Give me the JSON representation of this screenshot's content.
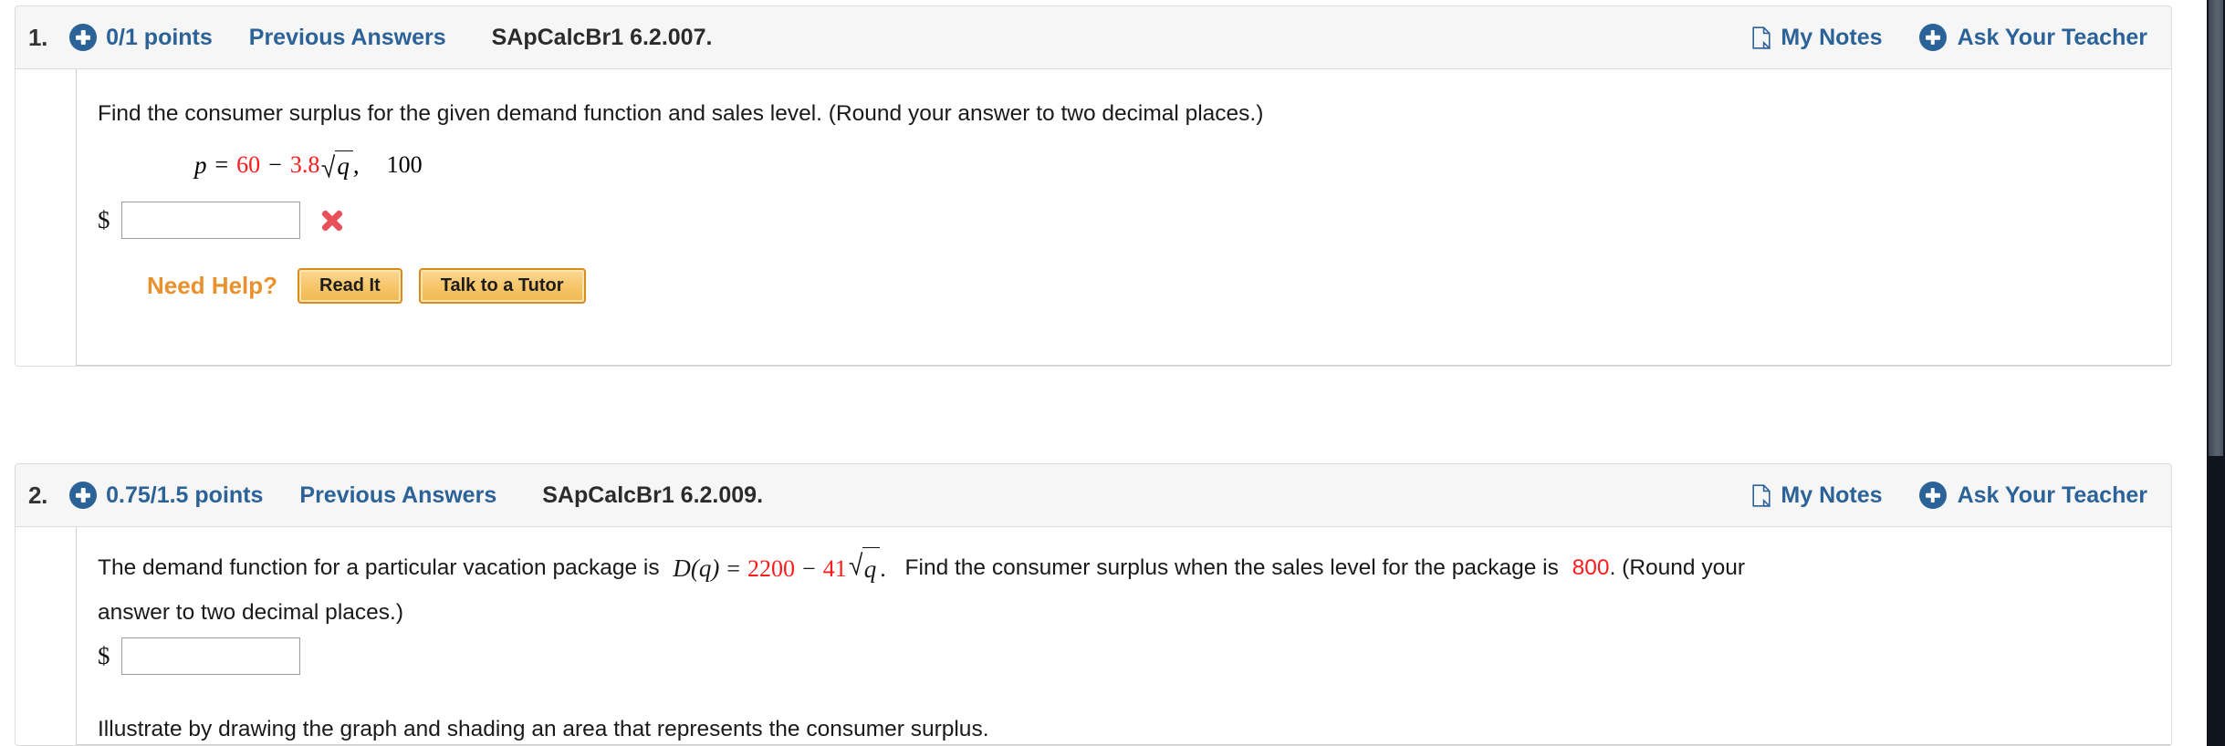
{
  "scrollbar": {
    "present": true
  },
  "problems": [
    {
      "number": "1.",
      "points": "0/1 points",
      "previous_answers": "Previous Answers",
      "code": "SApCalcBr1 6.2.007.",
      "my_notes": "My Notes",
      "ask_your_teacher": "Ask Your Teacher",
      "prompt": "Find the consumer surplus for the given demand function and sales level. (Round your answer to two decimal places.)",
      "equation": {
        "lhs": "p",
        "equals": "=",
        "coefficient_a": "60",
        "minus": "−",
        "coefficient_b": "3.8",
        "radicand": "q",
        "comma": ",",
        "sales_level": "100"
      },
      "currency_symbol": "$",
      "answer_value": "",
      "answer_placeholder": "",
      "answer_status": "incorrect",
      "need_help_label": "Need Help?",
      "help_buttons": [
        "Read It",
        "Talk to a Tutor"
      ]
    },
    {
      "number": "2.",
      "points": "0.75/1.5 points",
      "previous_answers": "Previous Answers",
      "code": "SApCalcBr1 6.2.009.",
      "my_notes": "My Notes",
      "ask_your_teacher": "Ask Your Teacher",
      "prompt_part1": "The demand function for a particular vacation package is",
      "equation": {
        "lhs": "D(q)",
        "equals": "=",
        "coefficient_a": "2200",
        "minus": "−",
        "coefficient_b": "41",
        "radicand": "q",
        "period": "."
      },
      "prompt_part2": "Find the consumer surplus when the sales level for the package is",
      "sales_level": "800",
      "prompt_part3": ". (Round your",
      "prompt_line2": "answer to two decimal places.)",
      "currency_symbol": "$",
      "answer_value": "",
      "answer_placeholder": "",
      "illustrate_text": "Illustrate by drawing the graph and shading an area that represents the consumer surplus."
    }
  ],
  "colors": {
    "link_blue": "#2b6298",
    "header_bg": "#f6f6f6",
    "math_red": "#ff1b1b",
    "need_help_orange": "#e8912d",
    "incorrect_red": "#e8515a",
    "button_amber": "#f2b951"
  }
}
